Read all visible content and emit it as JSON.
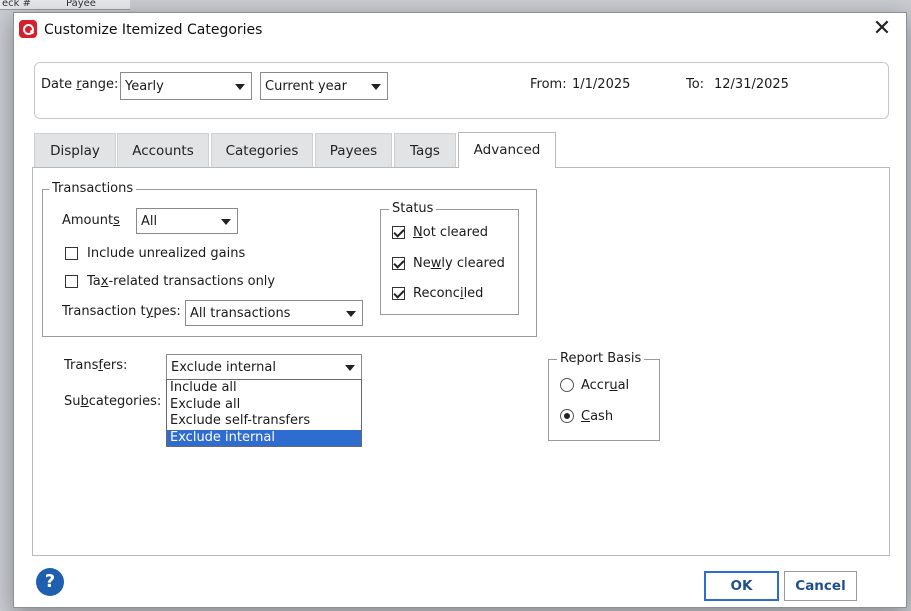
{
  "window": {
    "title": "Customize Itemized Categories"
  },
  "background": {
    "col1": "eck #",
    "col2": "Payee"
  },
  "date_range": {
    "label_pre": "Date ",
    "label_u": "r",
    "label_post": "ange:",
    "period": "Yearly",
    "year": "Current year",
    "from_label": "From:",
    "from_value": "1/1/2025",
    "to_label": "To:",
    "to_value": "12/31/2025"
  },
  "tabs": [
    "Display",
    "Accounts",
    "Categories",
    "Payees",
    "Tags",
    "Advanced"
  ],
  "transactions": {
    "group_title": "Transactions",
    "amounts_label_pre": "Amount",
    "amounts_label_u": "s",
    "amounts_value": "All",
    "unrealized_label": "Include unrealized gains",
    "taxrelated_pre": "Ta",
    "taxrelated_u": "x",
    "taxrelated_post": "-related transactions only",
    "types_label_pre": "Transaction t",
    "types_label_u": "y",
    "types_label_post": "pes:",
    "types_value": "All transactions"
  },
  "status": {
    "group_title": "Status",
    "not_cleared_u": "N",
    "not_cleared_post": "ot cleared",
    "newly_pre": "Ne",
    "newly_u": "w",
    "newly_post": "ly cleared",
    "recon_pre": "Reconc",
    "recon_u": "i",
    "recon_post": "led"
  },
  "transfers": {
    "label_pre": "Trans",
    "label_u": "f",
    "label_post": "ers:",
    "value": "Exclude internal",
    "options": [
      "Include all",
      "Exclude all",
      "Exclude self-transfers",
      "Exclude internal"
    ]
  },
  "subcategories": {
    "label_pre": "Su",
    "label_u": "b",
    "label_post": "categories:"
  },
  "report_basis": {
    "group_title": "Report Basis",
    "accrual_pre": "Accr",
    "accrual_u": "u",
    "accrual_post": "al",
    "cash_u": "C",
    "cash_post": "ash"
  },
  "footer": {
    "help": "?",
    "ok": "OK",
    "cancel": "Cancel"
  },
  "colors": {
    "accent": "#2f6ccf",
    "brand": "#d61f2c",
    "help": "#1f5fb0"
  }
}
